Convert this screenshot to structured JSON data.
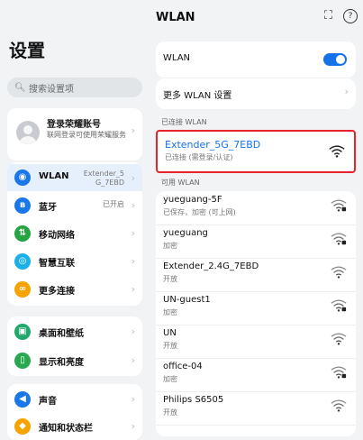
{
  "left": {
    "title": "设置",
    "search_placeholder": "搜索设置项",
    "account": {
      "name": "登录荣耀账号",
      "desc": "联网登录可使用荣耀服务"
    },
    "groups": [
      {
        "items": [
          {
            "label": "WLAN",
            "value": "Extender_5 G_7EBD",
            "icon_color": "#1977ea",
            "icon": "wifi-icon",
            "glyph": "◉",
            "selected": true
          },
          {
            "label": "蓝牙",
            "value": "已开启",
            "icon_color": "#1977ea",
            "icon": "bluetooth-icon",
            "glyph": "ʙ"
          },
          {
            "label": "移动网络",
            "value": "",
            "icon_color": "#25a541",
            "icon": "mobile-network-icon",
            "glyph": "⇅"
          },
          {
            "label": "智慧互联",
            "value": "",
            "icon_color": "#1bb0e8",
            "icon": "smart-connect-icon",
            "glyph": "◎"
          },
          {
            "label": "更多连接",
            "value": "",
            "icon_color": "#f4a300",
            "icon": "link-icon",
            "glyph": "∞"
          }
        ]
      },
      {
        "items": [
          {
            "label": "桌面和壁纸",
            "value": "",
            "icon_color": "#21a86b",
            "icon": "wallpaper-icon",
            "glyph": "▣"
          },
          {
            "label": "显示和亮度",
            "value": "",
            "icon_color": "#2aa84f",
            "icon": "display-icon",
            "glyph": "▯"
          }
        ]
      },
      {
        "items": [
          {
            "label": "声音",
            "value": "",
            "icon_color": "#1977ea",
            "icon": "sound-icon",
            "glyph": "◀"
          },
          {
            "label": "通知和状态栏",
            "value": "",
            "icon_color": "#f4a300",
            "icon": "notification-icon",
            "glyph": "◆"
          }
        ]
      }
    ]
  },
  "right": {
    "title": "WLAN",
    "wlan_label": "WLAN",
    "more_settings": "更多 WLAN 设置",
    "connected_header": "已连接 WLAN",
    "connected": {
      "name": "Extender_5G_7EBD",
      "sub": "已连接 (需登录/认证)"
    },
    "available_header": "可用 WLAN",
    "networks": [
      {
        "name": "yueguang-5F",
        "sub": "已保存，加密 (可上网)",
        "locked": true
      },
      {
        "name": "yueguang",
        "sub": "加密",
        "locked": true
      },
      {
        "name": "Extender_2.4G_7EBD",
        "sub": "开放",
        "locked": false
      },
      {
        "name": "UN-guest1",
        "sub": "加密",
        "locked": true
      },
      {
        "name": "UN",
        "sub": "开放",
        "locked": false
      },
      {
        "name": "office-04",
        "sub": "加密",
        "locked": true
      },
      {
        "name": "Philips S6505",
        "sub": "开放",
        "locked": false
      }
    ],
    "accent": "#1672e8",
    "highlight_color": "#e8242b"
  }
}
